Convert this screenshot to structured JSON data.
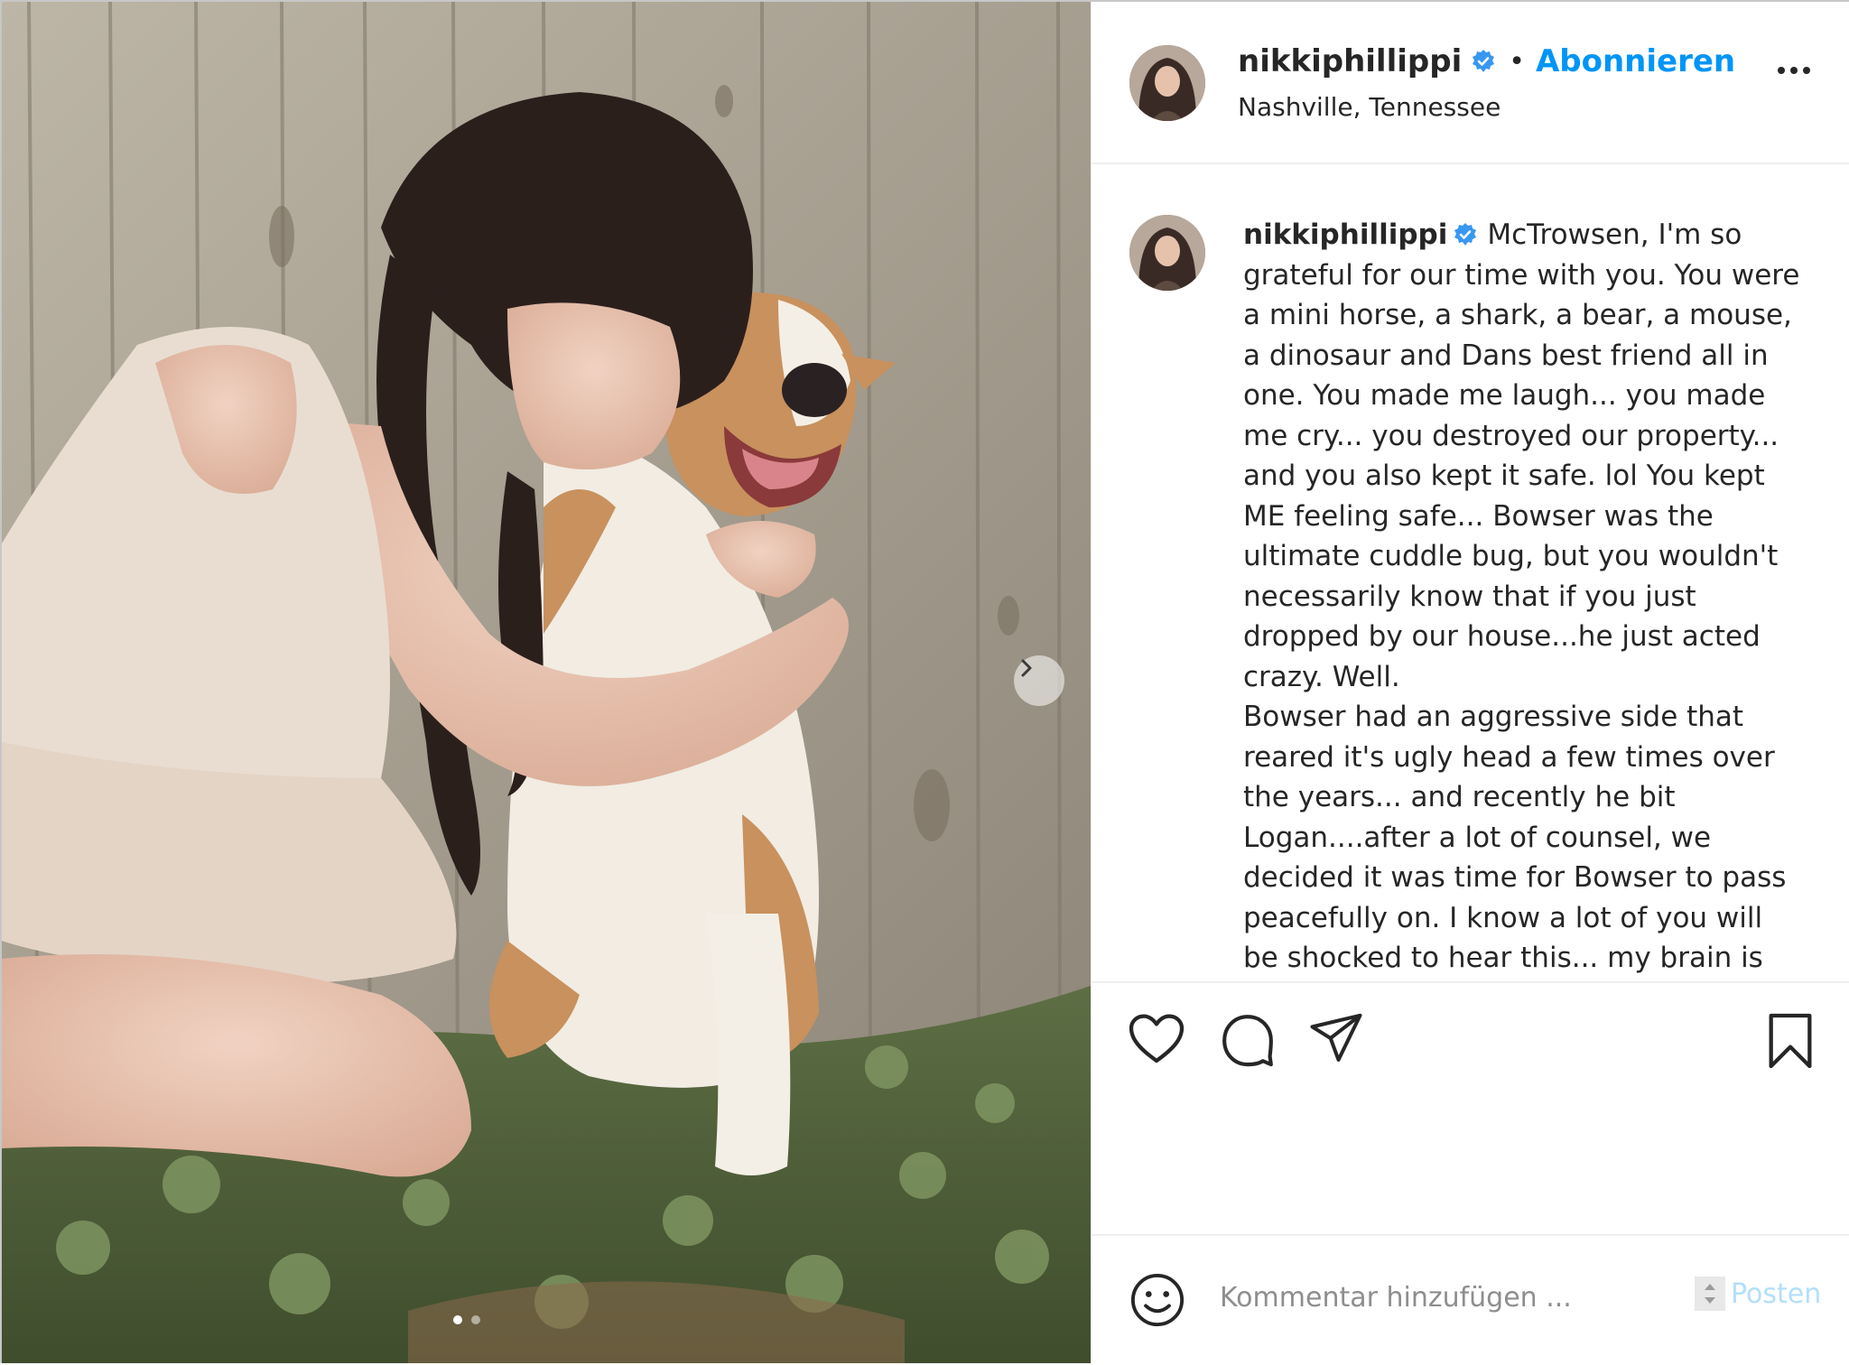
{
  "post": {
    "username": "nikkiphillippi",
    "follow_separator": "•",
    "follow_label": "Abonnieren",
    "location": "Nashville, Tennessee",
    "caption_text": "McTrowsen, I'm so grateful for our time with you. You were a mini horse, a shark, a bear, a mouse, a dinosaur and Dans best friend all in one. You made me laugh... you made me cry... you destroyed our property... and you also kept it safe. lol You kept ME feeling safe... Bowser was the ultimate cuddle bug, but you wouldn't necessarily know that if you just dropped by our house...he just acted crazy. Well.\nBowser had an aggressive side that reared it's ugly head a few times over the years... and recently he bit Logan....after a lot of counsel, we decided it was time for Bowser to pass peacefully on. I know a lot of you will be shocked to hear this... my brain is",
    "carousel": {
      "slide_count": 2,
      "active_slide": 1
    }
  },
  "comment": {
    "placeholder": "Kommentar hinzufügen ...",
    "post_label": "Posten"
  },
  "icons": {
    "verified": "verified-badge-icon",
    "more": "more-options-icon",
    "like": "heart-icon",
    "comment": "comment-bubble-icon",
    "share": "paper-plane-icon",
    "save": "bookmark-icon",
    "emoji": "smiley-icon",
    "next": "chevron-right-icon"
  },
  "colors": {
    "accent": "#0095f6",
    "text": "#262626",
    "muted": "#8e8e8e",
    "post_disabled": "#b2dffc",
    "divider": "#efefef"
  }
}
